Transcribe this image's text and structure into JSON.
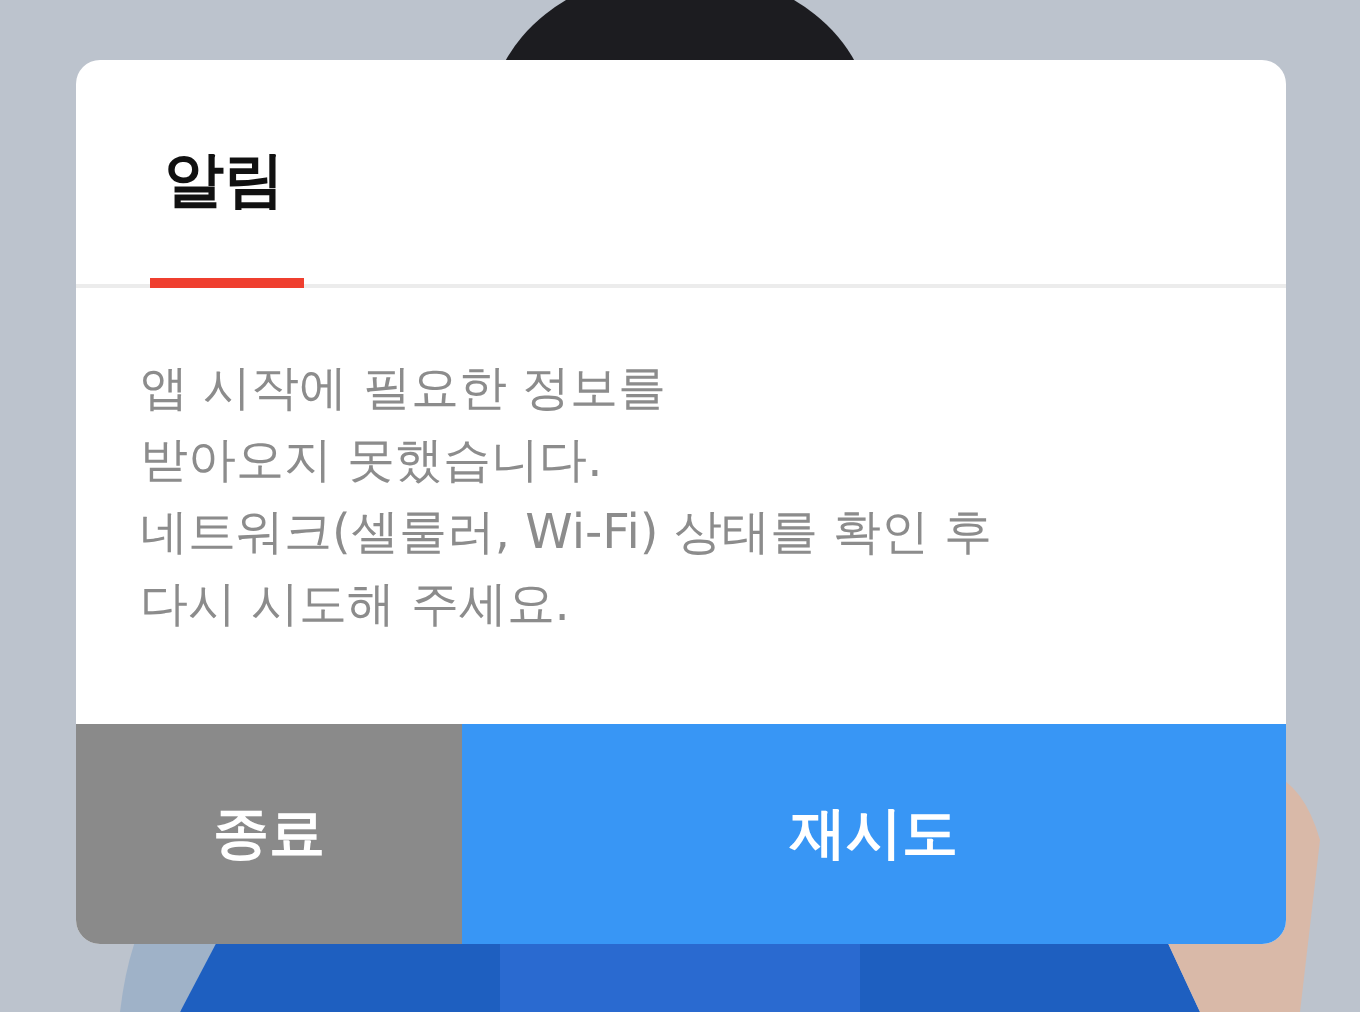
{
  "dialog": {
    "title": "알림",
    "message": "앱 시작에 필요한 정보를\n받아오지 못했습니다.\n네트워크(셀룰러, Wi-Fi) 상태를 확인 후\n다시 시도해 주세요.",
    "buttons": [
      {
        "label": "종료",
        "kind": "secondary"
      },
      {
        "label": "재시도",
        "kind": "primary"
      }
    ]
  }
}
